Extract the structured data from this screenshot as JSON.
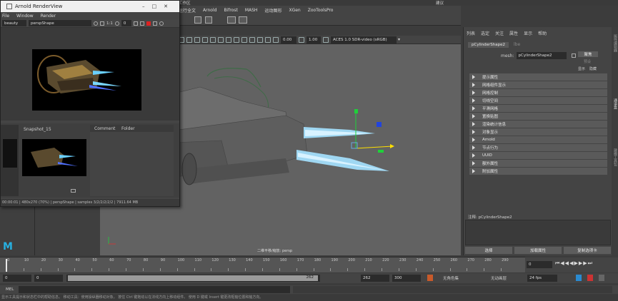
{
  "topbar": {
    "workspace": "工作区",
    "trailing": "建议"
  },
  "main_menu": [
    "运行全文",
    "Arnold",
    "Bifrost",
    "MASH",
    "运动图形",
    "XGen",
    "ZooToolsPro"
  ],
  "viewport": {
    "exposure": "0.00",
    "gamma": "1.00",
    "colorspace": "ACES 1.0 SDR-video (sRGB)",
    "camera_label": "二维平移/缩放: persp"
  },
  "channel_box": {
    "menus": [
      "列表",
      "选定",
      "关注",
      "属性",
      "显示",
      "帮助"
    ],
    "tab_active": "pCylinderShape2",
    "tab_other": "lbe",
    "mesh_label": "mesh:",
    "mesh_value": "pCylinderShape2",
    "focus_btn": "聚焦",
    "preset_btn": "预设",
    "show_btn": "显示",
    "hide_btn": "隐藏",
    "sections": [
      "提示属性",
      "网格组件显示",
      "网格控制",
      "切线空间",
      "平滑网格",
      "置换贴图",
      "渲染统计信息",
      "对象显示",
      "Arnold",
      "节点行为",
      "UUID",
      "额外属性",
      "附加属性"
    ],
    "notes_label": "注释: pCylinderShape2",
    "select_btn": "选择",
    "load_btn": "加载属性",
    "copy_btn": "复制选项卡"
  },
  "right_side_tabs": [
    "通道盒",
    "属性编辑器",
    "建模工具包"
  ],
  "renderview": {
    "title": "Arnold RenderView",
    "menu": [
      "File",
      "Window",
      "Render"
    ],
    "aov": "beauty",
    "camera": "perspShape",
    "zoom": "1:1",
    "exposure": "0",
    "snapshot_label": "Snapshot_15",
    "comment_tab": "Comment",
    "folder_tab": "Folder",
    "status": "00:00:01 | 480x270 (70%) | perspShape | samples 3/2/2/2/2/2 | 7911.64 MB"
  },
  "timeline": {
    "ticks": [
      "0",
      "10",
      "20",
      "30",
      "40",
      "50",
      "60",
      "70",
      "80",
      "90",
      "100",
      "110",
      "120",
      "130",
      "140",
      "150",
      "160",
      "170",
      "180",
      "190",
      "200",
      "210",
      "220",
      "230",
      "240",
      "250",
      "260",
      "270",
      "280",
      "290"
    ],
    "current_frame": "0"
  },
  "range": {
    "start": "0",
    "playback_start": "0",
    "playback_end": "262",
    "range_end": "262",
    "end": "300",
    "char_set": "无角色集",
    "anim_layer": "无动画层",
    "fps": "24 fps"
  },
  "command": {
    "label": "MEL"
  },
  "help_line": "显示工具提示和状态栏中的帮助信息。  移动工具：使用操纵器移动对象。  按住 Ctrl 键拖动以在法线方向上移动组件。 使用 D 键或 Insert 键更改枢轴位置和轴方向。"
}
